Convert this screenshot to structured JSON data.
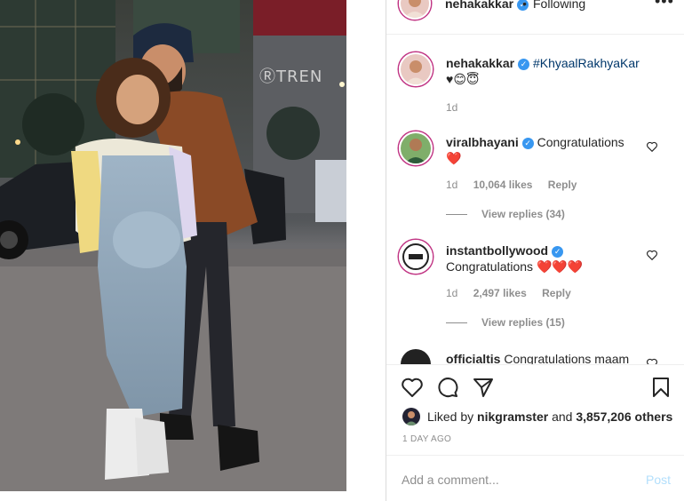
{
  "post": {
    "photo_alt": "",
    "author": "nehakakkar",
    "follow_sep": "•",
    "follow_state": "Following",
    "more_label": "•••"
  },
  "caption": {
    "username": "nehakakkar",
    "hashtag": "#KhyaalRakhyaKar",
    "emojis": "♥😊😇",
    "time": "1d"
  },
  "comments": [
    {
      "username": "viralbhayani",
      "text": "Congratulations",
      "hearts": "❤️",
      "time": "1d",
      "likes": "10,064 likes",
      "reply": "Reply",
      "view_replies": "View replies (34)"
    },
    {
      "username": "instantbollywood",
      "text": "Congratulations",
      "hearts": "❤️❤️❤️",
      "time": "1d",
      "likes": "2,497 likes",
      "reply": "Reply",
      "view_replies": "View replies (15)"
    },
    {
      "username": "officialtis",
      "text": "Congratulations maam"
    }
  ],
  "likes": {
    "prefix": "Liked by",
    "user": "nikgramster",
    "joiner": "and",
    "others": "3,857,206 others"
  },
  "timestamp": "1 DAY AGO",
  "add_comment": {
    "placeholder": "Add a comment...",
    "post_label": "Post"
  },
  "colors": {
    "verified": "#3897f0",
    "link": "#00376b",
    "heart": "#ed4956",
    "muted": "#8e8e8e",
    "post_disabled": "#b2dffc"
  }
}
